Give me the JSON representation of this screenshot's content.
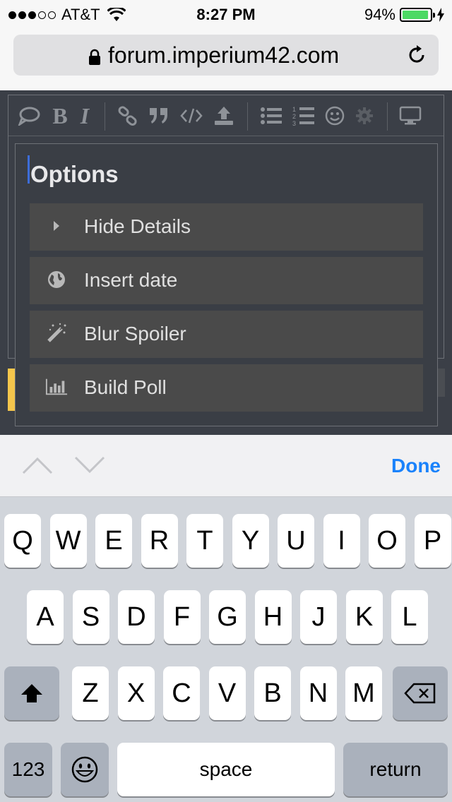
{
  "status_bar": {
    "carrier": "AT&T",
    "time": "8:27 PM",
    "battery": "94%",
    "battery_level": 0.94,
    "signal_bars_filled": 3,
    "signal_bars_total": 5
  },
  "url_bar": {
    "url": "forum.imperium42.com"
  },
  "editor_toolbar": {
    "bold_label": "B",
    "italic_label": "I"
  },
  "options_popup": {
    "title": "Options",
    "items": [
      {
        "label": "Hide Details",
        "icon": "triangle-right-icon"
      },
      {
        "label": "Insert date",
        "icon": "globe-icon"
      },
      {
        "label": "Blur Spoiler",
        "icon": "magic-wand-icon"
      },
      {
        "label": "Build Poll",
        "icon": "bar-chart-icon"
      }
    ]
  },
  "accessory_bar": {
    "done_label": "Done"
  },
  "keyboard": {
    "row1": [
      "Q",
      "W",
      "E",
      "R",
      "T",
      "Y",
      "U",
      "I",
      "O",
      "P"
    ],
    "row2": [
      "A",
      "S",
      "D",
      "F",
      "G",
      "H",
      "J",
      "K",
      "L"
    ],
    "row3": [
      "Z",
      "X",
      "C",
      "V",
      "B",
      "N",
      "M"
    ],
    "numbers_label": "123",
    "space_label": "space",
    "return_label": "return"
  },
  "colors": {
    "accent": "#1a82fb",
    "battery_green": "#4cd964",
    "page_background": "#3b3f47",
    "option_background": "#4a4a4a",
    "highlight_tab": "#f5c64c"
  }
}
